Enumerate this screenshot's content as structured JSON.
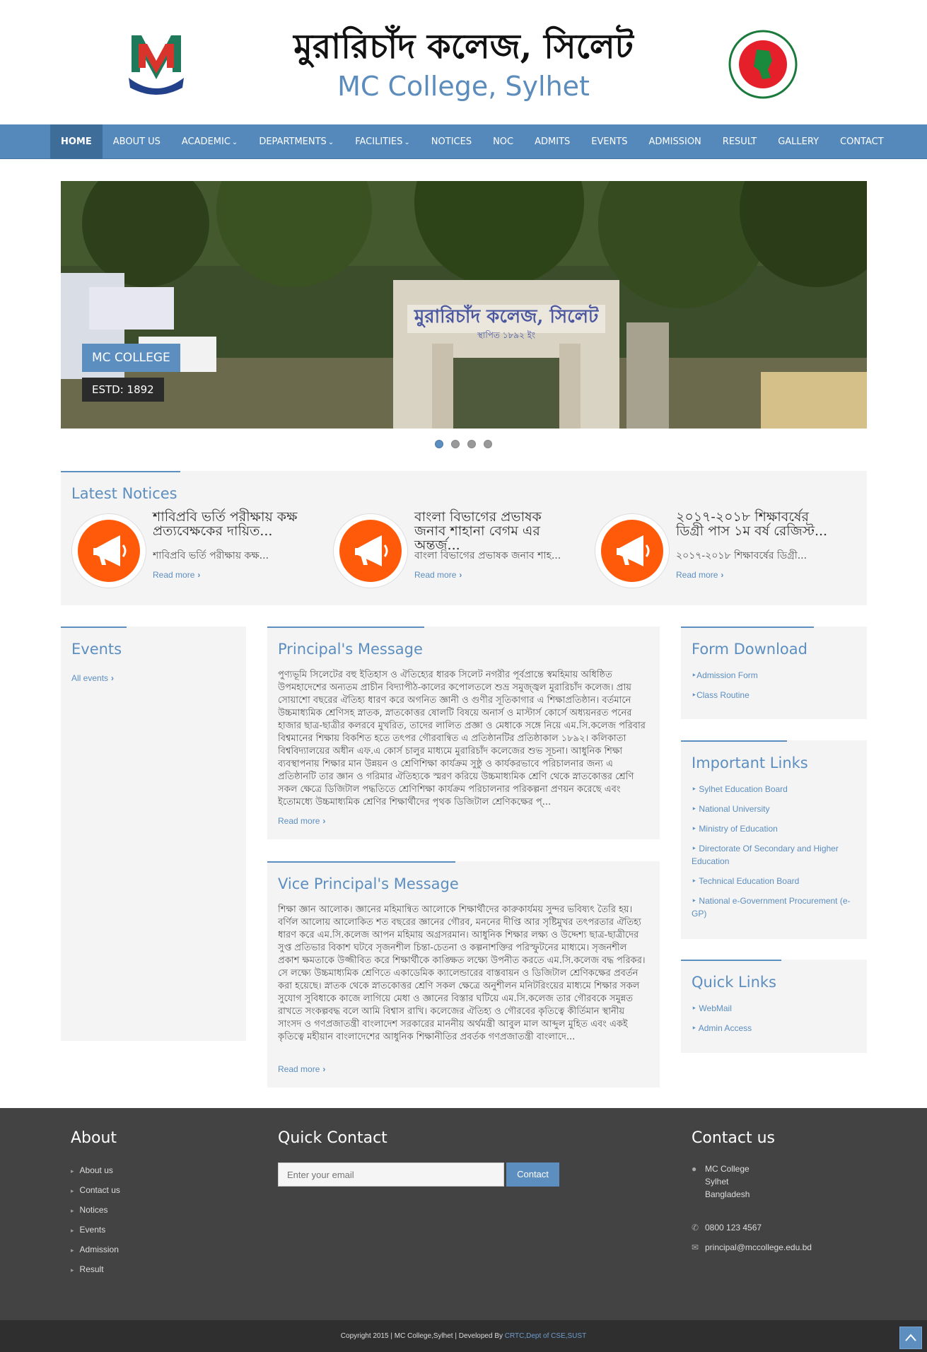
{
  "header": {
    "title_bn": "মুরারিচাঁদ কলেজ, সিলেট",
    "title_en": "MC College, Sylhet",
    "logo_left_icon": "mc-college-logo-icon",
    "logo_right_icon": "bangladesh-govt-seal-icon"
  },
  "nav": {
    "items": [
      {
        "label": "HOME",
        "active": true,
        "dropdown": false
      },
      {
        "label": "ABOUT US",
        "active": false,
        "dropdown": false
      },
      {
        "label": "ACADEMIC",
        "active": false,
        "dropdown": true
      },
      {
        "label": "DEPARTMENTS",
        "active": false,
        "dropdown": true
      },
      {
        "label": "FACILITIES",
        "active": false,
        "dropdown": true
      },
      {
        "label": "NOTICES",
        "active": false,
        "dropdown": false
      },
      {
        "label": "NOC",
        "active": false,
        "dropdown": false
      },
      {
        "label": "ADMITS",
        "active": false,
        "dropdown": false
      },
      {
        "label": "EVENTS",
        "active": false,
        "dropdown": false
      },
      {
        "label": "ADMISSION",
        "active": false,
        "dropdown": false
      },
      {
        "label": "RESULT",
        "active": false,
        "dropdown": false
      },
      {
        "label": "GALLERY",
        "active": false,
        "dropdown": false
      },
      {
        "label": "CONTACT",
        "active": false,
        "dropdown": false
      }
    ]
  },
  "slider": {
    "caption_title": "MC COLLEGE",
    "caption_sub": "ESTD: 1892",
    "gate_text_bn": "মুরারিচাঁদ কলেজ, সিলেট",
    "gate_sub_bn": "স্থাপিত ১৮৯২ ইং",
    "dot_count": 4,
    "active_dot": 0
  },
  "notices": {
    "title": "Latest Notices",
    "read_more": "Read more",
    "items": [
      {
        "title": "শাবিপ্রবি ভর্তি পরীক্ষায় কক্ষ প্রত্যবেক্ষকের দায়িত...",
        "summary": "শাবিপ্রবি ভর্তি পরীক্ষায় কক্ষ..."
      },
      {
        "title": "বাংলা বিভাগের প্রভাষক জনাব শাহানা বেগম এর অন্তর্জ...",
        "summary": "বাংলা বিভাগের প্রভাষক জনাব শাহ..."
      },
      {
        "title": "২০১৭-২০১৮ শিক্ষাবর্ষের ডিগ্রী পাস ১ম বর্ষ রেজিস্ট...",
        "summary": "২০১৭-২০১৮ শিক্ষাবর্ষের ডিগ্রী..."
      }
    ]
  },
  "events": {
    "title": "Events",
    "all_link": "All events"
  },
  "principal": {
    "title": "Principal's Message",
    "text": "পুণ্যভূমি সিলেটের বহু ইতিহাস ও ঐতিহ্যের ধারক সিলেট নগরীর পূর্বপ্রান্তে স্বমহিমায় অধিষ্ঠিত উপমহাদেশের অন্যতম প্রাচীন বিদ্যাপীঠ-কালের কপোলতলে শুভ্র সমুজ্জ্বল মুরারিচাঁদ কলেজ। প্রায় সোয়াশো বছরের ঐতিহ্য ধারণ করে অগনিত জ্ঞানী ও গুণীর সূতিকাগার এ শিক্ষাপ্রতিষ্ঠান। বর্তমানে উচ্চমাধ্যমিক শ্রেণিসহ স্নাতক, স্নাতকোত্তর ষোলটি বিষয়ে অনার্স ও মাস্টার্স কোর্সে অধ্যয়নরত পনের হাজার ছাত্র-ছাত্রীর কলরবে মুখরিত, তাদের লালিত প্রজ্ঞা ও মেধাকে সঙ্গে নিয়ে এম.সি.কলেজ পরিবার বিশ্বমানের শিক্ষায় বিকশিত হতে তৎপর গৌরবান্বিত এ প্রতিষ্ঠানটির প্রতিষ্ঠাকাল ১৮৯২। কলিকাতা বিশ্ববিদ্যালয়ের অধীন এফ.এ কোর্স চালুর মাধ্যমে মুরারিচাঁদ কলেজের শুভ সূচনা। আধুনিক শিক্ষা ব্যবস্থাপনায় শিক্ষার মান উন্নয়ন ও শ্রেণিশিক্ষা কার্যক্রম সুষ্ঠু ও কার্যকরভাবে পরিচালনার জন্য এ প্রতিষ্ঠানটি তার জ্ঞান ও গরিমার ঐতিহ্যকে স্মরণ করিয়ে উচ্চমাধ্যমিক শ্রেণি থেকে স্নাতকোত্তর শ্রেণি সকল ক্ষেত্রে ডিজিটাল পদ্ধতিতে শ্রেণিশিক্ষা কার্যক্রম পরিচালনার পরিকল্পনা প্রণয়ন করেছে এবং ইতোমধ্যে উচ্চমাধ্যমিক শ্রেণির শিক্ষার্থীদের পৃথক ডিজিটাল শ্রেণিকক্ষের প্...",
    "read_more": "Read more"
  },
  "vice_principal": {
    "title": "Vice Principal's Message",
    "text": "শিক্ষা জ্ঞান আলোক। জ্ঞানের মহিমান্বিত আলোকে শিক্ষার্থীদের কারুকার্যময় সুন্দর ভবিষ্যৎ তৈরি হয়। বর্ণিল আলোয় আলোকিত শত বছরের জ্ঞানের গৌরব, মননের দীপ্তি আর সৃষ্টিমুখর তৎপরতার ঐতিহ্য ধারণ করে এম.সি.কলেজ আপন মহিমায় অগ্রসরমান। আধুনিক শিক্ষার লক্ষ্য ও উদ্দেশ্য ছাত্র-ছাত্রীদের সুপ্ত প্রতিভার বিকাশ ঘটবে সৃজনশীল চিন্তা-চেতনা ও কল্পনাশক্তির পরিস্ফুটনের মাধ্যমে। সৃজনশীল প্রকাশ ক্ষমতাকে উজ্জীবিত করে শিক্ষার্থীকে কাঙ্ক্ষিত লক্ষ্যে উপনীত করতে এম.সি.কলেজ বদ্ধ পরিকর। সে লক্ষ্যে উচ্চমাধ্যমিক শ্রেণিতে একাডেমিক ক্যালেন্ডারের বাস্তবায়ন ও ডিজিটাল শ্রেণিকক্ষের প্রবর্তন করা হয়েছে। স্নাতক থেকে স্নাতকোত্তর শ্রেণি সকল ক্ষেত্রে অনুশীলন মনিটরিংয়ের মাধ্যমে শিক্ষার সকল সুযোগ সুবিধাকে কাজে লাগিয়ে মেধা ও জ্ঞানের বিস্তার ঘটিয়ে এম.সি.কলেজ তার গৌরবকে সমুন্নত রাখতে সংকল্পবদ্ধ বলে আমি বিশ্বাস রাখি। কলেজের ঐতিহ্য ও গৌরবের কৃতিত্বে কীর্তিমান স্থানীয় সাংসদ ও গণপ্রজাতন্ত্রী বাংলাদেশ সরকারের মাননীয় অর্থমন্ত্রী আবুল মাল আব্দুল মুহিত এবং একই কৃতিত্বে মহীয়ান বাংলাদেশের আধুনিক শিক্ষানীতির প্রবর্তক গণপ্রজাতন্ত্রী বাংলাদে...",
    "read_more": "Read more"
  },
  "form_download": {
    "title": "Form Download",
    "items": [
      "Admission Form",
      "Class Routine"
    ]
  },
  "important_links": {
    "title": "Important Links",
    "items": [
      "Sylhet Education Board",
      "National University",
      "Ministry of Education",
      "Directorate Of Secondary and Higher Education",
      "Technical Education Board",
      "National e-Government Procurement (e-GP)"
    ]
  },
  "quick_links": {
    "title": "Quick Links",
    "items": [
      "WebMail",
      "Admin Access"
    ]
  },
  "footer": {
    "about_title": "About",
    "about_items": [
      "About us",
      "Contact us",
      "Notices",
      "Events",
      "Admission",
      "Result"
    ],
    "quick_contact_title": "Quick Contact",
    "email_placeholder": "Enter your email",
    "contact_button": "Contact",
    "contact_title": "Contact us",
    "address_lines": [
      "MC College",
      "Sylhet",
      "Bangladesh"
    ],
    "phone": "0800 123 4567",
    "email": "principal@mccollege.edu.bd",
    "copyright": "Copyright 2015 | MC College,Sylhet | Developed By ",
    "developer": "CRTC,Dept of CSE,SUST"
  },
  "colors": {
    "accent": "#5c8ec0",
    "nav_bg": "#5589bb",
    "notice_icon": "#ff5a0a",
    "footer_bg": "#434343"
  }
}
